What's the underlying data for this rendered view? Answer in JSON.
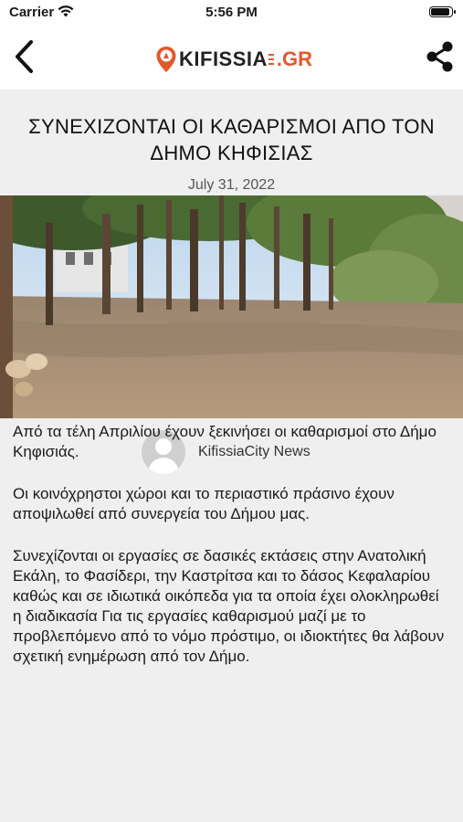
{
  "status_bar": {
    "carrier": "Carrier",
    "time": "5:56 PM",
    "battery_level": 1.0
  },
  "nav": {
    "back_icon": "chevron-left-icon",
    "share_icon": "share-icon",
    "logo": {
      "brand": "KIFISSIA",
      "tld": ".GR",
      "accent": "#e2592a"
    }
  },
  "article": {
    "title": "ΣΥΝΕΧΙΖΟΝΤΑΙ ΟΙ ΚΑΘΑΡΙΣΜΟΙ  ΑΠΟ ΤΟΝ ΔΗΜΟ ΚΗΦΙΣΙΑΣ",
    "date": "July 31, 2022",
    "author": "KifissiaCity News",
    "paragraphs": [
      "Από τα τέλη Απριλίου έχουν ξεκινήσει οι καθαρισμοί στο Δήμο Κηφισιάς.",
      "Οι κοινόχρηστοι χώροι και το περιαστικό πράσινο έχουν αποψιλωθεί από συνεργεία του Δήμου μας.",
      "Συνεχίζονται οι εργασίες σε δασικές εκτάσεις στην Ανατολική Εκάλη, το Φασίδερι, την Καστρίτσα και το δάσος Κεφαλαρίου καθώς και σε ιδιωτικά οικόπεδα για τα οποία έχει ολοκληρωθεί η διαδικασία Για τις εργασίες καθαρισμού μαζί με το προβλεπόμενο από το νόμο πρόστιμο, οι ιδιοκτήτες θα λάβουν σχετική ενημέρωση από τον Δήμο."
    ]
  }
}
